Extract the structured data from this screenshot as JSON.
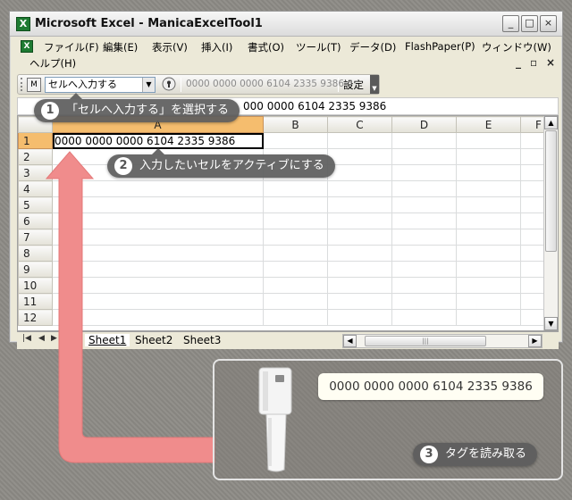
{
  "window": {
    "title": "Microsoft Excel - ManicaExcelTool1",
    "app_icon_letter": "X"
  },
  "menu": {
    "items": [
      "ファイル(F)",
      "編集(E)",
      "表示(V)",
      "挿入(I)",
      "書式(O)",
      "ツール(T)",
      "データ(D)",
      "FlashPaper(P)",
      "ウィンドウ(W)",
      "ヘルプ(H)"
    ],
    "doc_controls": [
      "_",
      "▫",
      "×"
    ]
  },
  "toolbar": {
    "select_value": "セルへ入力する",
    "tag_display": "0000 0000 0000 6104 2335 9386",
    "settings_label": "設定"
  },
  "formula_bar": {
    "value": "000 0000 6104 2335 9386"
  },
  "sheet": {
    "columns": [
      "A",
      "B",
      "C",
      "D",
      "E",
      "F"
    ],
    "active_column": "A",
    "rows": [
      "1",
      "2",
      "3",
      "4",
      "5",
      "6",
      "7",
      "8",
      "9",
      "10",
      "11",
      "12"
    ],
    "active_row": "1",
    "cell_A1": "0000 0000 0000 6104 2335 9386",
    "tabs": [
      "Sheet1",
      "Sheet2",
      "Sheet3"
    ],
    "active_tab": "Sheet1"
  },
  "callouts": {
    "step1": {
      "number": "1",
      "text": "「セルへ入力する」を選択する"
    },
    "step2": {
      "number": "2",
      "text": "入力したいセルをアクティブにする"
    },
    "step3": {
      "number": "3",
      "text": "タグを読み取る"
    }
  },
  "reader": {
    "tag_value": "0000 0000 0000 6104 2335 9386"
  },
  "colors": {
    "active_header": "#f5bd6e",
    "arrow": "#f08c8c",
    "callout_bg": "#5c5c5c",
    "excel_green": "#1e7b32"
  }
}
